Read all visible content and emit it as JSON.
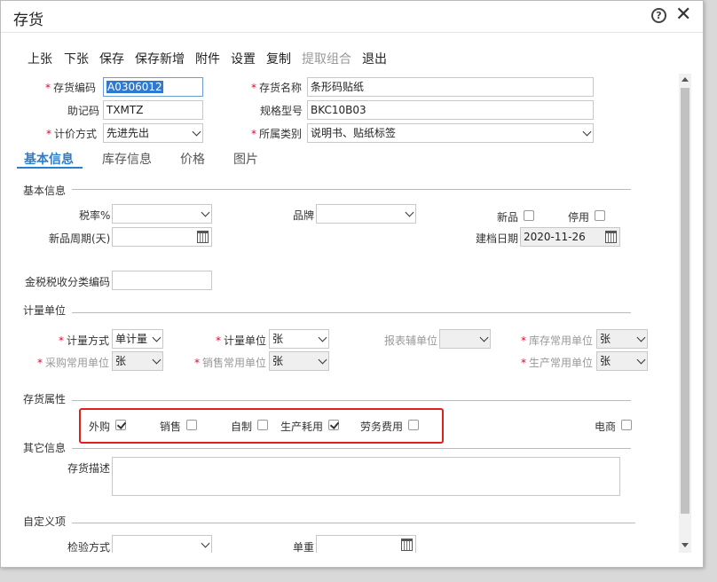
{
  "window": {
    "title": "存货"
  },
  "toolbar": [
    "上张",
    "下张",
    "保存",
    "保存新增",
    "附件",
    "设置",
    "复制",
    "提取组合",
    "退出"
  ],
  "header": {
    "code_label": "存货编码",
    "code_value": "A0306012",
    "name_label": "存货名称",
    "name_value": "条形码贴纸",
    "mnemonic_label": "助记码",
    "mnemonic_value": "TXMTZ",
    "spec_label": "规格型号",
    "spec_value": "BKC10B03",
    "pricing_label": "计价方式",
    "pricing_value": "先进先出",
    "category_label": "所属类别",
    "category_value": "说明书、贴纸标签"
  },
  "tabs": [
    "基本信息",
    "库存信息",
    "价格",
    "图片"
  ],
  "basic": {
    "section": "基本信息",
    "tax_label": "税率%",
    "tax_value": "",
    "brand_label": "品牌",
    "brand_value": "",
    "new_label": "新品",
    "disabled_label": "停用",
    "new_period_label": "新品周期(天)",
    "new_period_value": "",
    "created_label": "建档日期",
    "created_value": "2020-11-26",
    "tax_code_label": "金税税收分类编码",
    "tax_code_value": ""
  },
  "units": {
    "section": "计量单位",
    "method_label": "计量方式",
    "method_value": "单计量",
    "unit_label": "计量单位",
    "unit_value": "张",
    "report_label": "报表辅单位",
    "report_value": "",
    "stock_label": "库存常用单位",
    "stock_value": "张",
    "purchase_label": "采购常用单位",
    "purchase_value": "张",
    "sales_label": "销售常用单位",
    "sales_value": "张",
    "production_label": "生产常用单位",
    "production_value": "张"
  },
  "attributes": {
    "section": "存货属性",
    "items": [
      {
        "label": "外购",
        "checked": true
      },
      {
        "label": "销售",
        "checked": false
      },
      {
        "label": "自制",
        "checked": false
      },
      {
        "label": "生产耗用",
        "checked": true
      },
      {
        "label": "劳务费用",
        "checked": false
      },
      {
        "label": "电商",
        "checked": false
      }
    ]
  },
  "other": {
    "section": "其它信息",
    "desc_label": "存货描述",
    "desc_value": ""
  },
  "custom": {
    "section": "自定义项",
    "inspect_label": "检验方式",
    "inspect_value": "",
    "weight_label": "单重",
    "weight_value": ""
  },
  "colors": {
    "accent": "#2a7ed0",
    "required": "#e03",
    "highlight": "#e02020",
    "selection": "#3079d0"
  }
}
